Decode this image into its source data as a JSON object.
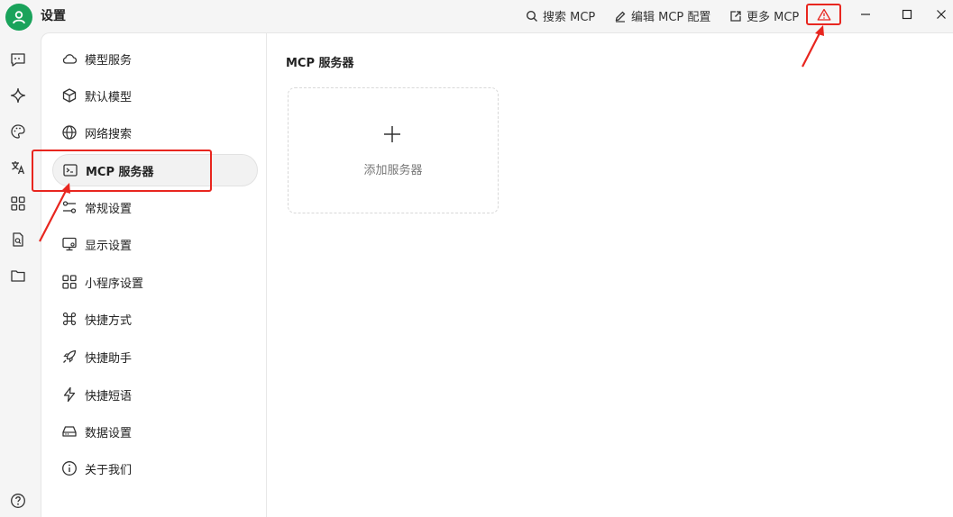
{
  "window": {
    "title": "设置"
  },
  "toolbar": {
    "search_mcp": "搜索 MCP",
    "edit_mcp_config": "编辑 MCP 配置",
    "more_mcp": "更多 MCP"
  },
  "rail": {
    "icons": [
      "chat-icon",
      "sparkle-icon",
      "palette-icon",
      "translate-icon",
      "grid-icon",
      "document-search-icon",
      "folder-icon",
      "help-icon"
    ]
  },
  "settings_nav": {
    "items": [
      {
        "label": "模型服务",
        "icon": "cloud-icon"
      },
      {
        "label": "默认模型",
        "icon": "cube-icon"
      },
      {
        "label": "网络搜索",
        "icon": "globe-icon"
      },
      {
        "label": "MCP 服务器",
        "icon": "terminal-icon",
        "active": true
      },
      {
        "label": "常规设置",
        "icon": "sliders-icon"
      },
      {
        "label": "显示设置",
        "icon": "monitor-icon"
      },
      {
        "label": "小程序设置",
        "icon": "apps-icon"
      },
      {
        "label": "快捷方式",
        "icon": "command-icon"
      },
      {
        "label": "快捷助手",
        "icon": "rocket-icon"
      },
      {
        "label": "快捷短语",
        "icon": "zap-icon"
      },
      {
        "label": "数据设置",
        "icon": "hard-drive-icon"
      },
      {
        "label": "关于我们",
        "icon": "info-icon"
      }
    ]
  },
  "main": {
    "title": "MCP 服务器",
    "add_server_label": "添加服务器"
  },
  "colors": {
    "accent": "#1aa35b",
    "annotation": "#e8261f"
  }
}
